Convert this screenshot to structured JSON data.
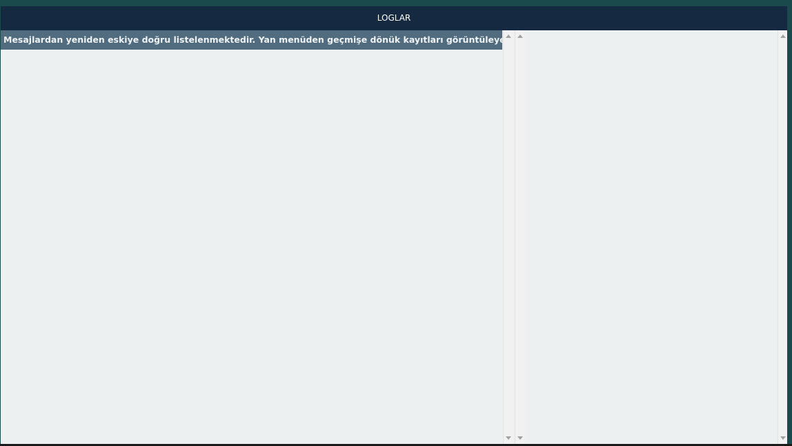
{
  "window": {
    "title": "LOGLAR"
  },
  "log_list": {
    "items": [
      "Mesajlardan yeniden eskiye doğru listelenmektedir. Yan menüden geçmişe dönük kayıtları görüntüleyebilirsiniz"
    ]
  },
  "colors": {
    "titlebar": "#152a40",
    "background": "#1b4a4c",
    "pane": "#edf0f1",
    "row_highlight": "#526c7f"
  }
}
